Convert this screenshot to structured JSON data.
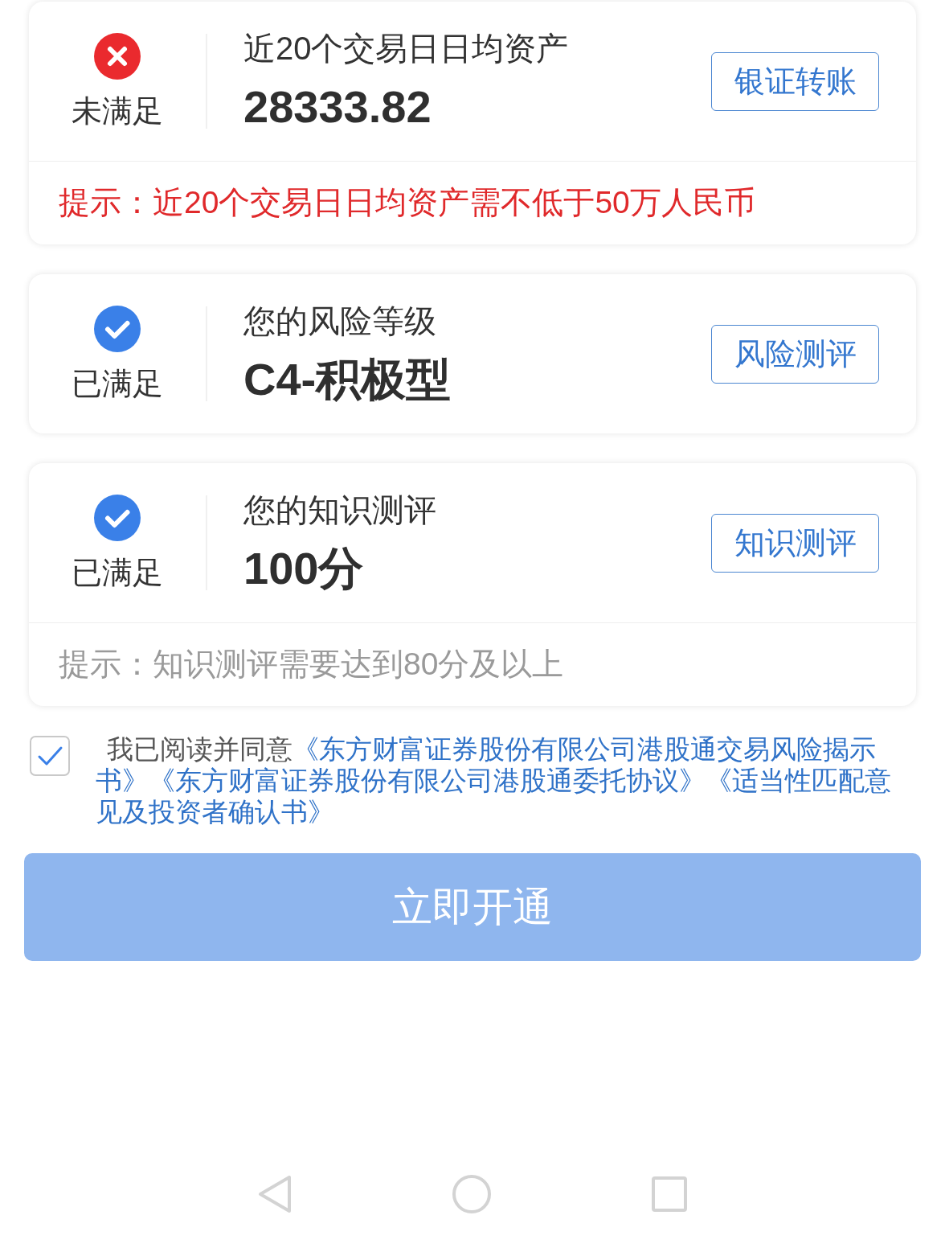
{
  "cards": [
    {
      "met": false,
      "status_label": "未满足",
      "title": "近20个交易日日均资产",
      "value": "28333.82",
      "action": "银证转账",
      "hint": {
        "kind": "warning",
        "text": "提示：近20个交易日日均资产需不低于50万人民币"
      }
    },
    {
      "met": true,
      "status_label": "已满足",
      "title": "您的风险等级",
      "value": "C4-积极型",
      "action": "风险测评"
    },
    {
      "met": true,
      "status_label": "已满足",
      "title": "您的知识测评",
      "value": "100分",
      "action": "知识测评",
      "hint": {
        "kind": "note",
        "text": "提示：知识测评需要达到80分及以上"
      }
    }
  ],
  "agreement": {
    "checked": true,
    "lead": "我已阅读并同意",
    "links": [
      "《东方财富证券股份有限公司港股通交易风险揭示书》",
      "《东方财富证券股份有限公司港股通委托协议》",
      "《适当性匹配意见及投资者确认书》"
    ]
  },
  "submit": {
    "label": "立即开通",
    "disabled": true
  }
}
